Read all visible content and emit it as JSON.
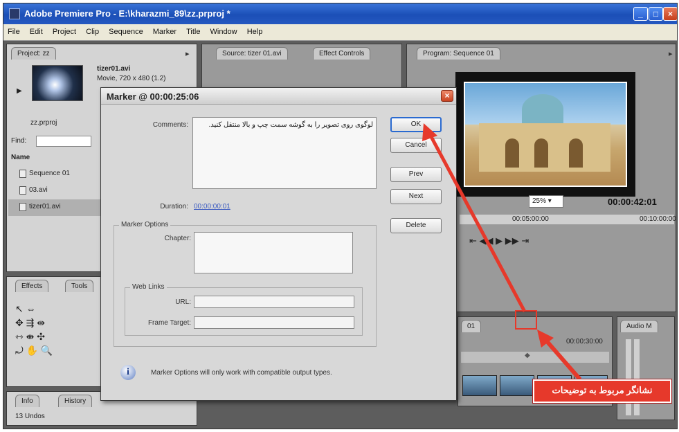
{
  "window": {
    "title": "Adobe Premiere Pro - E:\\kharazmi_89\\zz.prproj *"
  },
  "menu": [
    "File",
    "Edit",
    "Project",
    "Clip",
    "Sequence",
    "Marker",
    "Title",
    "Window",
    "Help"
  ],
  "project_panel": {
    "tab": "Project: zz",
    "clip_name": "tizer01.avi",
    "clip_info": "Movie, 720 x 480 (1.2)",
    "project_file": "zz.prproj",
    "find_label": "Find:",
    "name_header": "Name",
    "items": [
      "Sequence 01",
      "03.avi",
      "tizer01.avi"
    ]
  },
  "source_tabs": [
    "Source: tizer 01.avi",
    "Effect Controls"
  ],
  "program_monitor": {
    "tab": "Program: Sequence 01",
    "zoom": "25%",
    "timecode": "00:00:42:01",
    "ruler_a": "00:05:00:00",
    "ruler_b": "00:10:00:00"
  },
  "effects_panel": {
    "tabs": [
      "Effects",
      "Tools"
    ]
  },
  "timeline": {
    "tab": "01",
    "timecode": "00:00:30:00"
  },
  "audio_panel": {
    "tab": "Audio M"
  },
  "info_panel": {
    "tabs": [
      "Info",
      "History"
    ],
    "undo": "13 Undos"
  },
  "dialog": {
    "title": "Marker @ 00:00:25:06",
    "comments_label": "Comments:",
    "comments_value": "لوگوی روی تصویر را به گوشه سمت چپ و بالا منتقل کنید.",
    "duration_label": "Duration:",
    "duration_value": "00:00:00:01",
    "marker_options_label": "Marker Options",
    "chapter_label": "Chapter:",
    "web_links_label": "Web Links",
    "url_label": "URL:",
    "frame_target_label": "Frame Target:",
    "info_text": "Marker Options will only work with compatible output types.",
    "buttons": {
      "ok": "OK",
      "cancel": "Cancel",
      "prev": "Prev",
      "next": "Next",
      "delete": "Delete"
    }
  },
  "annotation": {
    "callout_text": "نشانگر مربوط به توضیحات",
    "color": "#e6392b"
  }
}
